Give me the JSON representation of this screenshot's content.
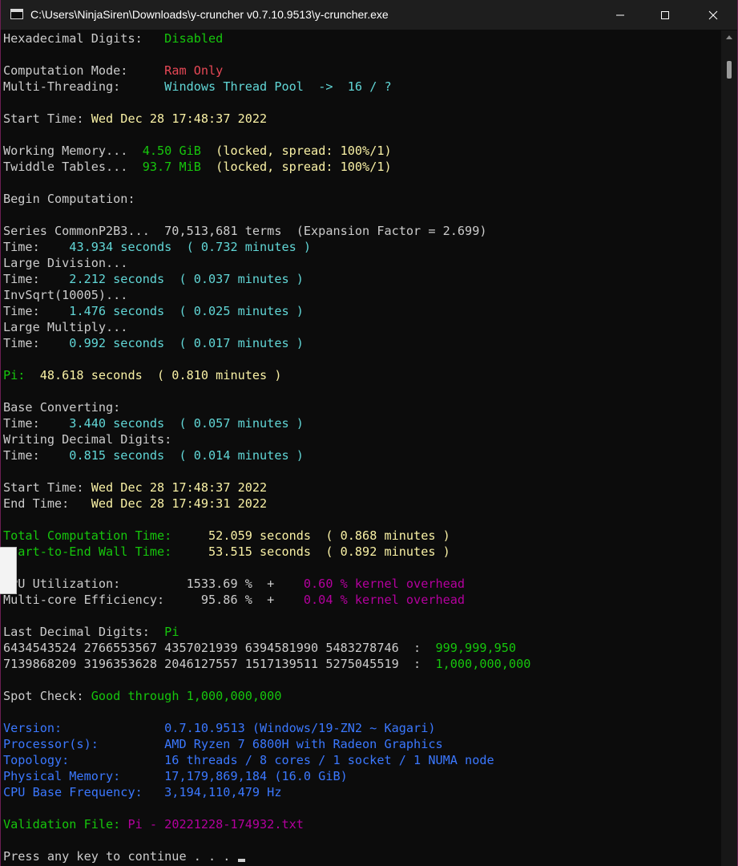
{
  "window": {
    "title": "C:\\Users\\NinjaSiren\\Downloads\\y-cruncher v0.7.10.9513\\y-cruncher.exe",
    "controls": {
      "minimize": "minimize",
      "maximize": "maximize",
      "close": "close"
    }
  },
  "console": {
    "lines": [
      {
        "id": "hex",
        "segments": [
          [
            "Hexadecimal Digits:   ",
            "w"
          ],
          [
            "Disabled",
            "g"
          ]
        ]
      },
      {
        "id": "blank-1",
        "segments": []
      },
      {
        "id": "comp-mode",
        "segments": [
          [
            "Computation Mode:     ",
            "w"
          ],
          [
            "Ram Only",
            "r"
          ]
        ]
      },
      {
        "id": "multithreading",
        "segments": [
          [
            "Multi-Threading:      ",
            "w"
          ],
          [
            "Windows Thread Pool  ->  16 / ?",
            "c"
          ]
        ]
      },
      {
        "id": "blank-2",
        "segments": []
      },
      {
        "id": "start-time-1",
        "segments": [
          [
            "Start Time: ",
            "w"
          ],
          [
            "Wed Dec 28 17:48:37 2022",
            "y"
          ]
        ]
      },
      {
        "id": "blank-3",
        "segments": []
      },
      {
        "id": "working-memory",
        "segments": [
          [
            "Working Memory...  ",
            "w"
          ],
          [
            "4.50 GiB",
            "g"
          ],
          [
            "  (locked, spread: 100%/1)",
            "y"
          ]
        ]
      },
      {
        "id": "twiddle-tables",
        "segments": [
          [
            "Twiddle Tables...  ",
            "w"
          ],
          [
            "93.7 MiB",
            "g"
          ],
          [
            "  (locked, spread: 100%/1)",
            "y"
          ]
        ]
      },
      {
        "id": "blank-4",
        "segments": []
      },
      {
        "id": "begin-computation",
        "segments": [
          [
            "Begin Computation:",
            "w"
          ]
        ]
      },
      {
        "id": "blank-5",
        "segments": []
      },
      {
        "id": "series",
        "segments": [
          [
            "Series CommonP2B3...  70,513,681 terms  (Expansion Factor = 2.699)",
            "w"
          ]
        ]
      },
      {
        "id": "time-series",
        "segments": [
          [
            "Time:    ",
            "w"
          ],
          [
            "43.934 seconds  ( 0.732 minutes )",
            "c"
          ]
        ]
      },
      {
        "id": "large-division",
        "segments": [
          [
            "Large Division...",
            "w"
          ]
        ]
      },
      {
        "id": "time-division",
        "segments": [
          [
            "Time:    ",
            "w"
          ],
          [
            "2.212 seconds  ( 0.037 minutes )",
            "c"
          ]
        ]
      },
      {
        "id": "invsqrt",
        "segments": [
          [
            "InvSqrt(10005)...",
            "w"
          ]
        ]
      },
      {
        "id": "time-invsqrt",
        "segments": [
          [
            "Time:    ",
            "w"
          ],
          [
            "1.476 seconds  ( 0.025 minutes )",
            "c"
          ]
        ]
      },
      {
        "id": "large-multiply",
        "segments": [
          [
            "Large Multiply...",
            "w"
          ]
        ]
      },
      {
        "id": "time-multiply",
        "segments": [
          [
            "Time:    ",
            "w"
          ],
          [
            "0.992 seconds  ( 0.017 minutes )",
            "c"
          ]
        ]
      },
      {
        "id": "blank-6",
        "segments": []
      },
      {
        "id": "pi-time",
        "segments": [
          [
            "Pi:  ",
            "g"
          ],
          [
            "48.618 seconds  ( 0.810 minutes )",
            "y"
          ]
        ]
      },
      {
        "id": "blank-7",
        "segments": []
      },
      {
        "id": "base-converting",
        "segments": [
          [
            "Base Converting:",
            "w"
          ]
        ]
      },
      {
        "id": "time-base",
        "segments": [
          [
            "Time:    ",
            "w"
          ],
          [
            "3.440 seconds  ( 0.057 minutes )",
            "c"
          ]
        ]
      },
      {
        "id": "writing-digits",
        "segments": [
          [
            "Writing Decimal Digits:",
            "w"
          ]
        ]
      },
      {
        "id": "time-writing",
        "segments": [
          [
            "Time:    ",
            "w"
          ],
          [
            "0.815 seconds  ( 0.014 minutes )",
            "c"
          ]
        ]
      },
      {
        "id": "blank-8",
        "segments": []
      },
      {
        "id": "start-time-2",
        "segments": [
          [
            "Start Time: ",
            "w"
          ],
          [
            "Wed Dec 28 17:48:37 2022",
            "y"
          ]
        ]
      },
      {
        "id": "end-time",
        "segments": [
          [
            "End Time:   ",
            "w"
          ],
          [
            "Wed Dec 28 17:49:31 2022",
            "y"
          ]
        ]
      },
      {
        "id": "blank-9",
        "segments": []
      },
      {
        "id": "total-time",
        "segments": [
          [
            "Total Computation Time:     ",
            "g"
          ],
          [
            "52.059 seconds  ( 0.868 minutes )",
            "y"
          ]
        ]
      },
      {
        "id": "wall-time",
        "segments": [
          [
            "Start-to-End Wall Time:     ",
            "g"
          ],
          [
            "53.515 seconds  ( 0.892 minutes )",
            "y"
          ]
        ]
      },
      {
        "id": "blank-10",
        "segments": []
      },
      {
        "id": "cpu-util",
        "segments": [
          [
            "CPU Utilization:         1533.69 %  +    ",
            "w"
          ],
          [
            "0.60 % kernel overhead",
            "m"
          ]
        ]
      },
      {
        "id": "multicore",
        "segments": [
          [
            "Multi-core Efficiency:     95.86 %  +    ",
            "w"
          ],
          [
            "0.04 % kernel overhead",
            "m"
          ]
        ]
      },
      {
        "id": "blank-11",
        "segments": []
      },
      {
        "id": "last-digits",
        "segments": [
          [
            "Last Decimal Digits:  ",
            "w"
          ],
          [
            "Pi",
            "g"
          ]
        ]
      },
      {
        "id": "digits-1",
        "segments": [
          [
            "6434543524 2766553567 4357021939 6394581990 5483278746  :  ",
            "w"
          ],
          [
            "999,999,950",
            "g"
          ]
        ]
      },
      {
        "id": "digits-2",
        "segments": [
          [
            "7139868209 3196353628 2046127557 1517139511 5275045519  :  ",
            "w"
          ],
          [
            "1,000,000,000",
            "g"
          ]
        ]
      },
      {
        "id": "blank-12",
        "segments": []
      },
      {
        "id": "spot-check",
        "segments": [
          [
            "Spot Check: ",
            "w"
          ],
          [
            "Good through 1,000,000,000",
            "g"
          ]
        ]
      },
      {
        "id": "blank-13",
        "segments": []
      },
      {
        "id": "version",
        "segments": [
          [
            "Version:              0.7.10.9513 (Windows/19-ZN2 ~ Kagari)",
            "b"
          ]
        ]
      },
      {
        "id": "processor",
        "segments": [
          [
            "Processor(s):         AMD Ryzen 7 6800H with Radeon Graphics",
            "b"
          ]
        ]
      },
      {
        "id": "topology",
        "segments": [
          [
            "Topology:             16 threads / 8 cores / 1 socket / 1 NUMA node",
            "b"
          ]
        ]
      },
      {
        "id": "physical-memory",
        "segments": [
          [
            "Physical Memory:      17,179,869,184 (16.0 GiB)",
            "b"
          ]
        ]
      },
      {
        "id": "cpu-frequency",
        "segments": [
          [
            "CPU Base Frequency:   3,194,110,479 Hz",
            "b"
          ]
        ]
      },
      {
        "id": "blank-14",
        "segments": []
      },
      {
        "id": "validation-file",
        "segments": [
          [
            "Validation File: ",
            "g"
          ],
          [
            "Pi - 20221228-174932.txt",
            "m"
          ]
        ]
      },
      {
        "id": "blank-15",
        "segments": []
      },
      {
        "id": "press-any-key",
        "segments": [
          [
            "Press any key to continue . . . ",
            "w"
          ]
        ],
        "cursor": true
      }
    ]
  },
  "scrollbar": {
    "position": 0.0
  }
}
